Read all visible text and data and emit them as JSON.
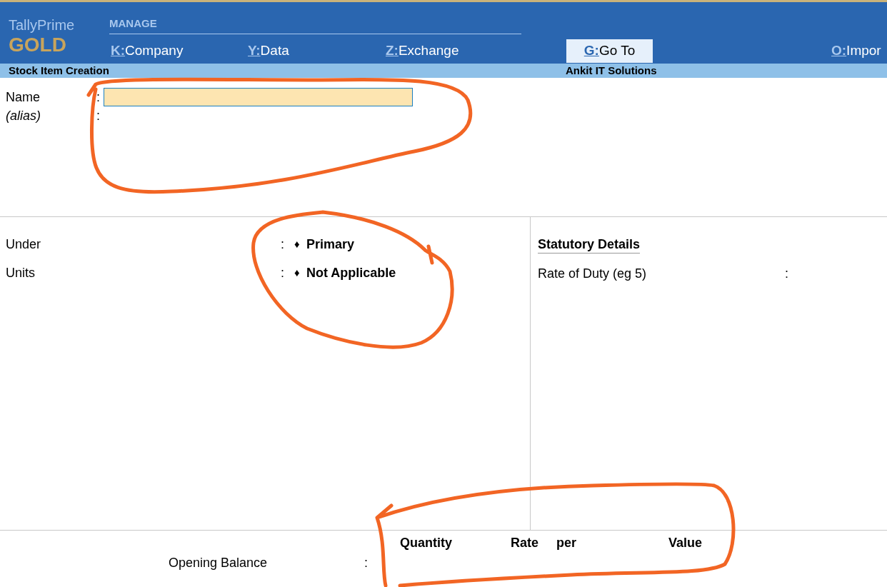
{
  "brand": {
    "product": "TallyPrime",
    "edition": "GOLD"
  },
  "menu": {
    "group": "MANAGE",
    "items": [
      {
        "key": "K:",
        "label": "Company",
        "selected": false
      },
      {
        "key": "Y:",
        "label": "Data",
        "selected": false
      },
      {
        "key": "Z:",
        "label": "Exchange",
        "selected": false
      },
      {
        "key": "G:",
        "label": "Go To",
        "selected": true
      },
      {
        "key": "O:",
        "label": "Impor",
        "selected": false
      }
    ]
  },
  "title_bar": {
    "screen": "Stock Item Creation",
    "company": "Ankit IT Solutions"
  },
  "name_section": {
    "name": {
      "label": "Name",
      "separator": ":"
    },
    "alias": {
      "label": "(alias)",
      "separator": ":"
    }
  },
  "fields": [
    {
      "label": "Under",
      "separator": ":",
      "marker": "♦",
      "value": "Primary"
    },
    {
      "label": "Units",
      "separator": ":",
      "marker": "♦",
      "value": "Not Applicable"
    }
  ],
  "statutory": {
    "heading": "Statutory Details",
    "rows": [
      {
        "label": "Rate of Duty (eg 5)",
        "separator": ":"
      }
    ]
  },
  "opening": {
    "columns": [
      "Quantity",
      "Rate",
      "per",
      "Value"
    ],
    "label": "Opening Balance",
    "separator": ":"
  }
}
